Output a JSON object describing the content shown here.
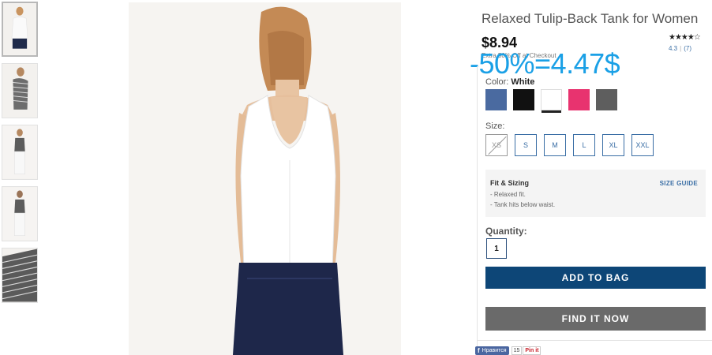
{
  "product": {
    "title": "Relaxed Tulip-Back Tank for Women",
    "price": "$8.94",
    "promo_note": "Extra 50% Off at Checkout",
    "overlay_price": "-50%=4.47$",
    "rating_stars": "★★★★☆",
    "rating_value": "4.3",
    "review_count": "(7)"
  },
  "color": {
    "label": "Color:",
    "selected": "White",
    "swatches": [
      {
        "name": "blue",
        "hex": "#4a6aa0"
      },
      {
        "name": "black",
        "hex": "#111111"
      },
      {
        "name": "white",
        "hex": "#ffffff"
      },
      {
        "name": "pink",
        "hex": "#e8336f"
      },
      {
        "name": "gray",
        "hex": "#5e5e5e"
      }
    ]
  },
  "size": {
    "label": "Size:",
    "options": [
      "XS",
      "S",
      "M",
      "L",
      "XL",
      "XXL"
    ],
    "unavailable": [
      "XS"
    ]
  },
  "fit": {
    "title": "Fit & Sizing",
    "size_guide": "SIZE GUIDE",
    "lines": [
      "- Relaxed fit.",
      "- Tank hits below waist."
    ]
  },
  "quantity": {
    "label": "Quantity:",
    "value": "1"
  },
  "buttons": {
    "add_to_bag": "ADD TO BAG",
    "find_it_now": "FIND IT NOW"
  },
  "social": {
    "facebook_label": "Нравится",
    "facebook_count": "15",
    "pinterest_label": "Pin it"
  },
  "colors": {
    "accent": "#0d4677",
    "link": "#3a6ea5",
    "overlay": "#1aa0e6",
    "secondary_button": "#6a6a6a"
  }
}
